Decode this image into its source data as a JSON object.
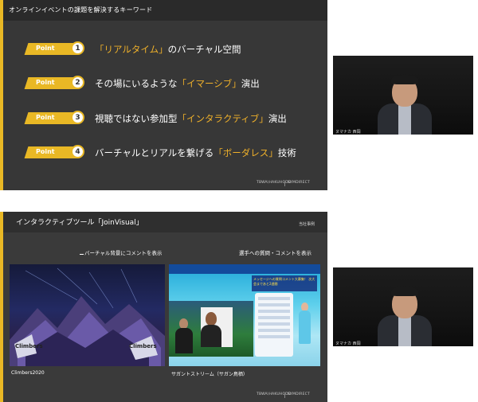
{
  "slide1": {
    "title": "オンラインイベントの課題を解決するキーワード",
    "points": [
      {
        "tag": "Point",
        "num": "1",
        "pre": "",
        "highlight": "「リアルタイム」",
        "post": "のバーチャル空間"
      },
      {
        "tag": "Point",
        "num": "2",
        "pre": "その場にいるような",
        "highlight": "「イマーシブ」",
        "post": "演出"
      },
      {
        "tag": "Point",
        "num": "3",
        "pre": "視聴ではない参加型",
        "highlight": "「インタラクティブ」",
        "post": "演出"
      },
      {
        "tag": "Point",
        "num": "4",
        "pre": "バーチャルとリアルを繋げる",
        "highlight": "「ボーダレス」",
        "post": "技術"
      }
    ],
    "footer_logos": [
      "TBWA\\HAKUHODO",
      "SYMDIRECT"
    ]
  },
  "speaker": {
    "name_top": "ヌマナカ 西岡",
    "name_bottom": "ヌマナカ 西岡"
  },
  "slide2": {
    "title": "インタラクティブツール「JoinVisual」",
    "corner_label": "当社事例",
    "caption_left": "バーチャル背景にコメントを表示",
    "caption_right": "選手への質問・コメントを表示",
    "image_left_label": "Climbers2020",
    "image_right_label": "サガントストリーム（サガン鳥栖）",
    "stage_text_left": "Climbers",
    "stage_text_right": "Climbers",
    "banner_text": "メッセージへの質問コメント大募集！ 次大会まであと2週間",
    "footer_logos": [
      "TBWA\\HAKUHODO",
      "SYMDIRECT"
    ]
  },
  "colors": {
    "accent": "#e9b825",
    "highlight_text": "#f0b12a",
    "slide_bg": "#373737"
  }
}
